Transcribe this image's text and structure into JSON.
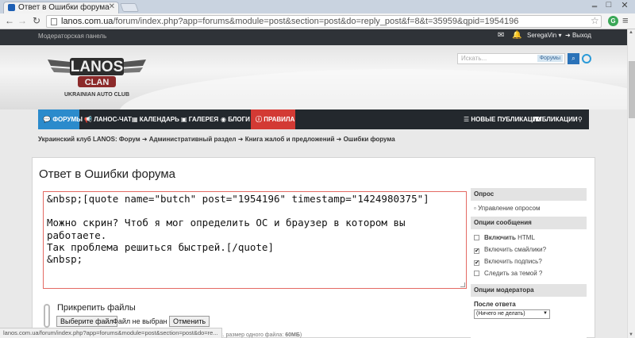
{
  "browser": {
    "tab_title": "Ответ в Ошибки форума",
    "url_host": "lanos.com.ua",
    "url_path": "/forum/index.php?app=forums&module=post&section=post&do=reply_post&f=8&t=35959&qpid=1954196",
    "status_url": "lanos.com.ua/forum/index.php?app=forums&module=post&section=post&do=re..."
  },
  "topbar": {
    "mod_panel": "Модераторская панель",
    "username": "SeregaVin",
    "logout": "Выход"
  },
  "header": {
    "logo_main": "LANOS",
    "logo_sub": "CLAN",
    "logo_tagline": "UKRAINIAN AUTO CLUB",
    "search_placeholder": "Искать...",
    "search_scope": "Форумы"
  },
  "nav": {
    "items": [
      "ФОРУМЫ",
      "ЛАНОС-ЧАТ",
      "КАЛЕНДАРЬ",
      "ГАЛЕРЕЯ",
      "БЛОГИ",
      "ПРАВИЛА"
    ],
    "right_items": [
      "НОВЫЕ ПУБЛИКАЦИИ",
      "ПУБЛИКАЦИИ"
    ]
  },
  "breadcrumb": [
    "Украинский клуб LANOS: Форум",
    "Административный раздел",
    "Книга жалоб и предложений",
    "Ошибки форума"
  ],
  "main": {
    "title": "Ответ в Ошибки форума",
    "editor_text": "&nbsp;[quote name=\"butch\" post=\"1954196\" timestamp=\"1424980375\"]\n\nМожно скрин? Чтоб я мог определить ОС и браузер в котором вы работаете.\nТак проблема решиться быстрей.[/quote]\n&nbsp;",
    "attach_title": "Прикрепить файлы",
    "choose_file": "Выберите файл",
    "no_file": "Файл не выбран",
    "cancel": "Отменить",
    "max_size_prefix": "е (Макс. размер одного файла: ",
    "max_size_value": "60МБ",
    "max_size_suffix": ")"
  },
  "sidebar": {
    "poll_header": "Опрос",
    "poll_manage": "Управление опросом",
    "msg_opts_header": "Опции сообщения",
    "html_bold": "Включить",
    "html_rest": "HTML",
    "smilies": "Включить смайлики?",
    "signature": "Включить подпись?",
    "follow": "Следить за темой ?",
    "mod_header": "Опции модератора",
    "after_reply_label": "После ответа",
    "after_reply_value": "(Ничего не делать)"
  },
  "checks": {
    "html": false,
    "smilies": true,
    "signature": true,
    "follow": false
  }
}
